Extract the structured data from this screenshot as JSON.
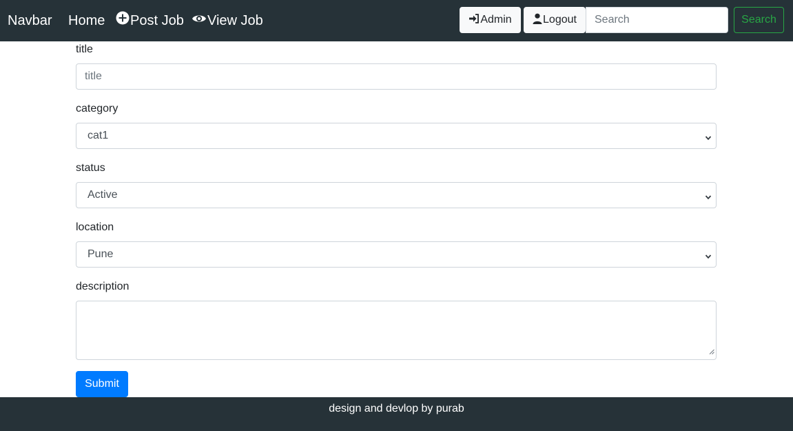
{
  "navbar": {
    "brand": "Navbar",
    "links": {
      "home": "Home",
      "post_job": "Post Job",
      "view_job": "View Job"
    },
    "admin_label": "Admin",
    "logout_label": "Logout",
    "search_placeholder": "Search",
    "search_button": "Search"
  },
  "form": {
    "title": {
      "label": "title",
      "placeholder": "title",
      "value": ""
    },
    "category": {
      "label": "category",
      "value": "cat1"
    },
    "status": {
      "label": "status",
      "value": "Active"
    },
    "location": {
      "label": "location",
      "value": "Pune"
    },
    "description": {
      "label": "description",
      "value": ""
    },
    "submit_label": "Submit"
  },
  "footer": {
    "text": "design and devlop by purab"
  },
  "colors": {
    "navbar_bg": "#263238",
    "primary": "#007bff",
    "success": "#28a745"
  }
}
